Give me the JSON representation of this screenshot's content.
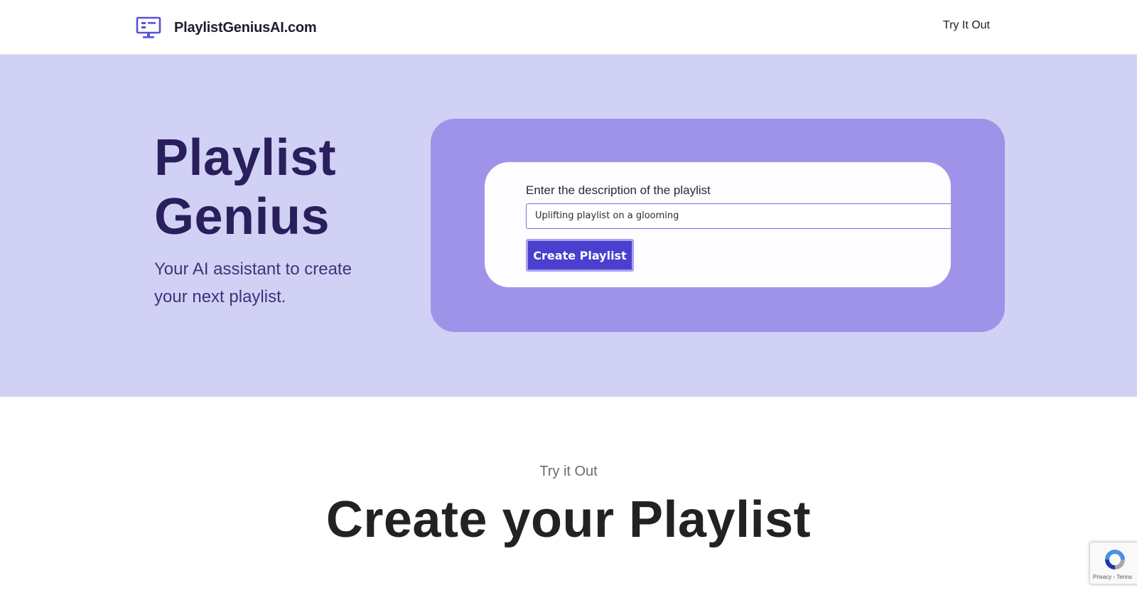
{
  "header": {
    "brand_name": "PlaylistGeniusAI.com",
    "brand_icon": "monitor-icon",
    "nav_try": "Try It Out"
  },
  "hero": {
    "title_line1": "Playlist",
    "title_line2": "Genius",
    "subtitle_line1": "Your AI assistant to create",
    "subtitle_line2": "your next playlist."
  },
  "demo": {
    "label": "Enter the description of the playlist",
    "input_value": "Uplifting playlist on a glooming",
    "button_label": "Create Playlist"
  },
  "section": {
    "kicker": "Try it Out",
    "title": "Create your Playlist"
  },
  "recaptcha": {
    "privacy": "Privacy",
    "separator": " - ",
    "terms": "Terms"
  },
  "colors": {
    "hero_bg": "#d1d1f5",
    "panel_bg": "#9f93e9",
    "accent": "#4a3fcf",
    "title_color": "#2a1f5c"
  }
}
